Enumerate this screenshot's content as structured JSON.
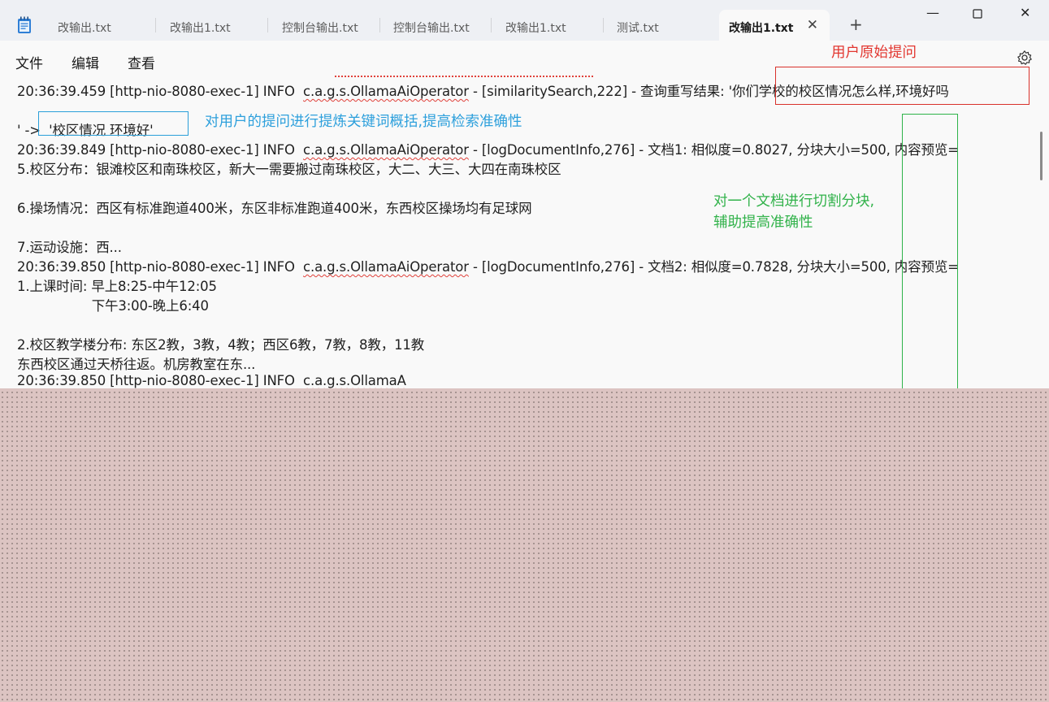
{
  "tabs": [
    {
      "label": "改输出.txt"
    },
    {
      "label": "改输出1.txt"
    },
    {
      "label": "控制台输出.txt"
    },
    {
      "label": "控制台输出.txt"
    },
    {
      "label": "改输出1.txt"
    },
    {
      "label": "测试.txt"
    },
    {
      "label": "改输出1.txt",
      "active": true
    }
  ],
  "tab_controls": {
    "close_glyph": "✕",
    "new_tab_glyph": "+"
  },
  "window_controls": {
    "minimize": "—",
    "maximize": "☐",
    "close": "✕"
  },
  "menu": {
    "file": "文件",
    "edit": "编辑",
    "view": "查看"
  },
  "icons": [
    "notepad-icon",
    "gear-icon"
  ],
  "editor": {
    "lines": [
      {
        "pre": "20:36:39.459 [http-nio-8080-exec-1] INFO  ",
        "squig": "c.a.g.s.OllamaAiOperator",
        "post": " - [similaritySearch,222] - 查询重写结果: '你们学校的校区情况怎么样,环境好吗"
      },
      {
        "pre": "' ->  '校区情况 环境好'",
        "squig": "",
        "post": ""
      },
      {
        "pre": "20:36:39.849 [http-nio-8080-exec-1] INFO  ",
        "squig": "c.a.g.s.OllamaAiOperator",
        "post": " - [logDocumentInfo,276] - 文档1: 相似度=0.8027, 分块大小=500, 内容预览="
      },
      {
        "pre": "5.校区分布：银滩校区和南珠校区，新大一需要搬过南珠校区，大二、大三、大四在南珠校区",
        "squig": "",
        "post": ""
      },
      {
        "pre": "6.操场情况：西区有标准跑道400米，东区非标准跑道400米，东西校区操场均有足球网",
        "squig": "",
        "post": ""
      },
      {
        "pre": "7.运动设施：西...",
        "squig": "",
        "post": ""
      },
      {
        "pre": "20:36:39.850 [http-nio-8080-exec-1] INFO  ",
        "squig": "c.a.g.s.OllamaAiOperator",
        "post": " - [logDocumentInfo,276] - 文档2: 相似度=0.7828, 分块大小=500, 内容预览="
      },
      {
        "pre": "1.上课时间: 早上8:25-中午12:05",
        "squig": "",
        "post": ""
      },
      {
        "pre": "                  下午3:00-晚上6:40",
        "squig": "",
        "post": ""
      },
      {
        "pre": "2.校区教学楼分布: 东区2教，3教，4教；西区6教，7教，8教，11教",
        "squig": "",
        "post": ""
      },
      {
        "pre": "东西校区通过天桥往返。机房教室在东...",
        "squig": "",
        "post": ""
      },
      {
        "pre": "20:36:39.850 [http-nio-8080-exec-1] INFO  ",
        "squig": "c.a.g.s.OllamaA",
        "post": ""
      }
    ]
  },
  "annotations": {
    "red_label": "用户原始提问",
    "blue_label": "对用户的提问进行提炼关键词概括,提高检索准确性",
    "green_label_line1": "对一个文档进行切割分块,",
    "green_label_line2": "辅助提高准确性"
  },
  "colors": {
    "annotation_red": "#e2362f",
    "annotation_blue": "#2ea0dc",
    "annotation_green": "#31b24a",
    "spellcheck_squiggle": "#e0413a"
  }
}
